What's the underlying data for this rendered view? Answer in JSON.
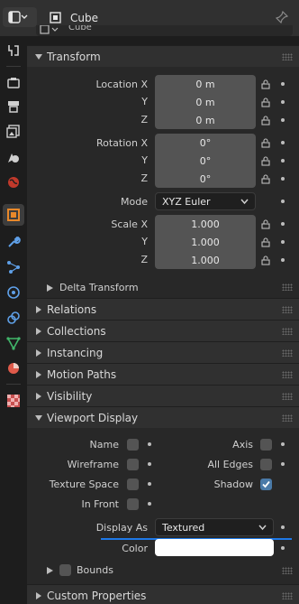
{
  "header": {
    "object_name": "Cube",
    "data_block_name": "Cube"
  },
  "panels": {
    "transform": {
      "title": "Transform",
      "location": {
        "label_x": "Location X",
        "label_y": "Y",
        "label_z": "Z",
        "x": "0 m",
        "y": "0 m",
        "z": "0 m"
      },
      "rotation": {
        "label_x": "Rotation X",
        "label_y": "Y",
        "label_z": "Z",
        "x": "0°",
        "y": "0°",
        "z": "0°"
      },
      "mode": {
        "label": "Mode",
        "value": "XYZ Euler"
      },
      "scale": {
        "label_x": "Scale X",
        "label_y": "Y",
        "label_z": "Z",
        "x": "1.000",
        "y": "1.000",
        "z": "1.000"
      },
      "delta_transform": "Delta Transform"
    },
    "relations": "Relations",
    "collections": "Collections",
    "instancing": "Instancing",
    "motion_paths": "Motion Paths",
    "visibility": "Visibility",
    "viewport_display": {
      "title": "Viewport Display",
      "name": "Name",
      "axis": "Axis",
      "wireframe": "Wireframe",
      "all_edges": "All Edges",
      "texture_space": "Texture Space",
      "shadow": "Shadow",
      "in_front": "In Front",
      "display_as": {
        "label": "Display As",
        "value": "Textured"
      },
      "color": {
        "label": "Color",
        "value": "#ffffff"
      },
      "bounds": "Bounds",
      "checked": {
        "name": false,
        "axis": false,
        "wireframe": false,
        "all_edges": false,
        "texture_space": false,
        "shadow": true,
        "in_front": false,
        "bounds": false
      }
    },
    "custom_properties": "Custom Properties"
  },
  "colors": {
    "accent_blue": "#1e78e6",
    "object_orange": "#e8882a",
    "checkbox_on": "#4a7aa8"
  }
}
